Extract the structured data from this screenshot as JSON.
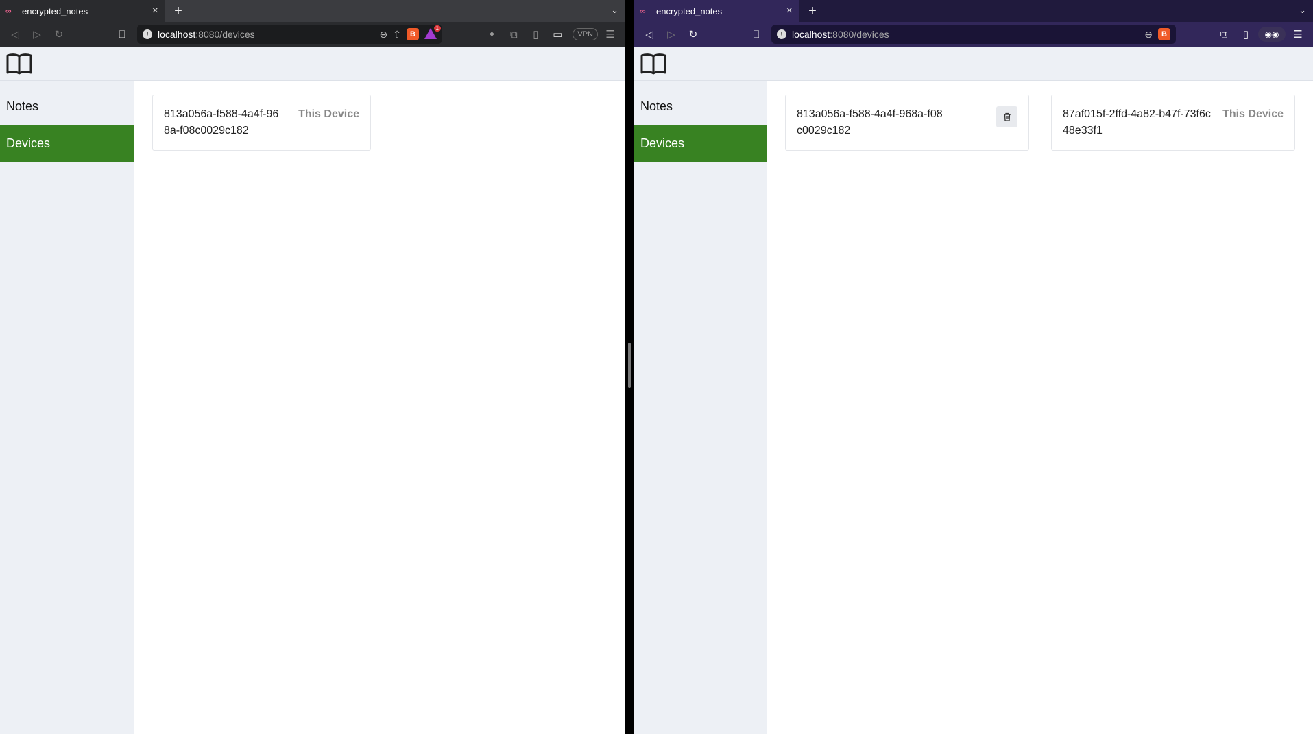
{
  "left_window": {
    "tab": {
      "title": "encrypted_notes",
      "close": "×",
      "new_tab": "+"
    },
    "url": {
      "host": "localhost",
      "rest": ":8080/devices"
    },
    "vpn_label": "VPN",
    "rewards_badge": "1",
    "nav": {
      "notes": "Notes",
      "devices": "Devices"
    },
    "devices": [
      {
        "id": "813a056a-f588-4a4f-968a-f08c0029c182",
        "tag": "This Device"
      }
    ]
  },
  "right_window": {
    "tab": {
      "title": "encrypted_notes",
      "close": "×",
      "new_tab": "+"
    },
    "url": {
      "host": "localhost",
      "rest": ":8080/devices"
    },
    "nav": {
      "notes": "Notes",
      "devices": "Devices"
    },
    "devices": [
      {
        "id": "813a056a-f588-4a4f-968a-f08c0029c182"
      },
      {
        "id": "87af015f-2ffd-4a82-b47f-73f6c48e33f1",
        "tag": "This Device"
      }
    ]
  },
  "colors": {
    "active_nav": "#388222",
    "sidebar_bg": "#edf0f5",
    "left_chrome": "#2a2b2e",
    "right_chrome": "#32275a"
  },
  "icons": [
    "tab-favicon-icon",
    "back-icon",
    "forward-icon",
    "reload-icon",
    "bookmark-icon",
    "site-info-icon",
    "zoom-icon",
    "share-icon",
    "brave-shield-icon",
    "brave-rewards-icon",
    "extensions-icon",
    "sidebar-icon",
    "wallet-icon",
    "menu-icon",
    "book-logo-icon",
    "trash-icon",
    "tabs-dropdown-icon",
    "private-glasses-icon"
  ]
}
